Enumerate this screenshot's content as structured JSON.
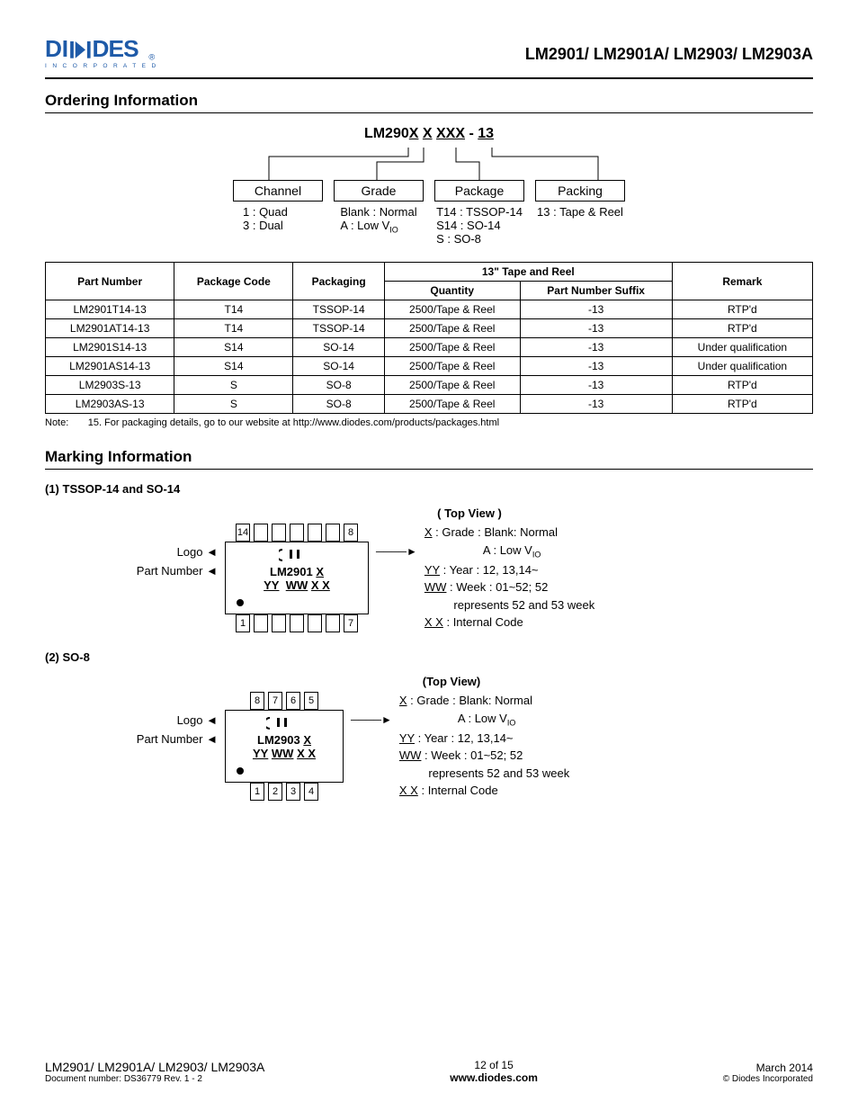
{
  "header": {
    "logo_main": "DIODES",
    "logo_sub": "I N C O R P O R A T E D",
    "title": "LM2901/ LM2901A/ LM2903/ LM2903A"
  },
  "section1": "Ordering Information",
  "pn": {
    "title_pre": "LM290",
    "title_x": "X",
    "title_x2": "X",
    "title_xxx": "XXX",
    "title_sfx": "13",
    "cols": [
      {
        "label": "Channel",
        "values": [
          "1 : Quad",
          "3 : Dual"
        ]
      },
      {
        "label": "Grade",
        "values": [
          "Blank : Normal",
          "A : Low V<sub>IO</sub>"
        ]
      },
      {
        "label": "Package",
        "values": [
          "T14 : TSSOP-14",
          "S14 : SO-14",
          "S : SO-8"
        ]
      },
      {
        "label": "Packing",
        "values": [
          "13 : Tape & Reel"
        ]
      }
    ]
  },
  "table": {
    "h_partnum": "Part Number",
    "h_pkgcode": "Package Code",
    "h_pkg": "Packaging",
    "h_tape": "13\" Tape and Reel",
    "h_qty": "Quantity",
    "h_sfx": "Part Number Suffix",
    "h_remark": "Remark",
    "rows": [
      {
        "pn": "LM2901T14-13",
        "code": "T14",
        "pkg": "TSSOP-14",
        "qty": "2500/Tape & Reel",
        "sfx": "-13",
        "rem": "RTP'd"
      },
      {
        "pn": "LM2901AT14-13",
        "code": "T14",
        "pkg": "TSSOP-14",
        "qty": "2500/Tape & Reel",
        "sfx": "-13",
        "rem": "RTP'd"
      },
      {
        "pn": "LM2901S14-13",
        "code": "S14",
        "pkg": "SO-14",
        "qty": "2500/Tape & Reel",
        "sfx": "-13",
        "rem": "Under qualification"
      },
      {
        "pn": "LM2901AS14-13",
        "code": "S14",
        "pkg": "SO-14",
        "qty": "2500/Tape & Reel",
        "sfx": "-13",
        "rem": "Under qualification"
      },
      {
        "pn": "LM2903S-13",
        "code": "S",
        "pkg": "SO-8",
        "qty": "2500/Tape & Reel",
        "sfx": "-13",
        "rem": "RTP'd"
      },
      {
        "pn": "LM2903AS-13",
        "code": "S",
        "pkg": "SO-8",
        "qty": "2500/Tape & Reel",
        "sfx": "-13",
        "rem": "RTP'd"
      }
    ]
  },
  "note": {
    "label": "Note:",
    "text": "15. For packaging details, go to our website at http://www.diodes.com/products/packages.html"
  },
  "section2": "Marking Information",
  "mark1": {
    "title": "(1)   TSSOP-14 and SO-14",
    "topview": "( Top View )",
    "pins_top_left": "14",
    "pins_top_right": "8",
    "pins_bot_left": "1",
    "pins_bot_right": "7",
    "left_logo": "Logo",
    "left_pn": "Part Number",
    "body_pn": "LM2901",
    "body_x": "X",
    "body_yy": "YY",
    "body_ww": "WW",
    "body_xx": "X X",
    "legend": [
      "<span class=u>X</span> : Grade : Blank: Normal",
      "&nbsp;&nbsp;&nbsp;&nbsp;&nbsp;&nbsp;&nbsp;&nbsp;&nbsp;&nbsp;&nbsp;&nbsp;&nbsp;&nbsp;&nbsp;&nbsp;&nbsp;&nbsp;A : Low V<sub>IO</sub>",
      "<span class=u>YY</span> : Year : 12, 13,14~",
      "<span class=u>WW</span> : Week : 01~52; 52",
      "&nbsp;&nbsp;&nbsp;&nbsp;&nbsp;&nbsp;&nbsp;&nbsp;&nbsp;represents 52 and 53 week",
      "<span class=u>X X</span> : Internal Code"
    ]
  },
  "mark2": {
    "title": "(2)   SO-8",
    "topview": "(Top View)",
    "pins_top": [
      "8",
      "7",
      "6",
      "5"
    ],
    "pins_bot": [
      "1",
      "2",
      "3",
      "4"
    ],
    "left_logo": "Logo",
    "left_pn": "Part Number",
    "body_pn": "LM2903",
    "body_x": "X",
    "body_yy": "YY",
    "body_ww": "WW",
    "body_xx": "X X",
    "legend": [
      "<span class=u>X</span> : Grade : Blank: Normal",
      "&nbsp;&nbsp;&nbsp;&nbsp;&nbsp;&nbsp;&nbsp;&nbsp;&nbsp;&nbsp;&nbsp;&nbsp;&nbsp;&nbsp;&nbsp;&nbsp;&nbsp;&nbsp;A : Low V<sub>IO</sub>",
      "<span class=u>YY</span> : Year : 12, 13,14~",
      "<span class=u>WW</span> : Week : 01~52; 52",
      "&nbsp;&nbsp;&nbsp;&nbsp;&nbsp;&nbsp;&nbsp;&nbsp;&nbsp;represents 52 and 53 week",
      "<span class=u>X X</span> : Internal Code"
    ]
  },
  "footer": {
    "left1": "LM2901/ LM2901A/ LM2903/ LM2903A",
    "left2": "Document number: DS36779  Rev. 1 - 2",
    "center1": "12 of 15",
    "center2": "www.diodes.com",
    "right1": "March 2014",
    "right2": "© Diodes Incorporated"
  }
}
